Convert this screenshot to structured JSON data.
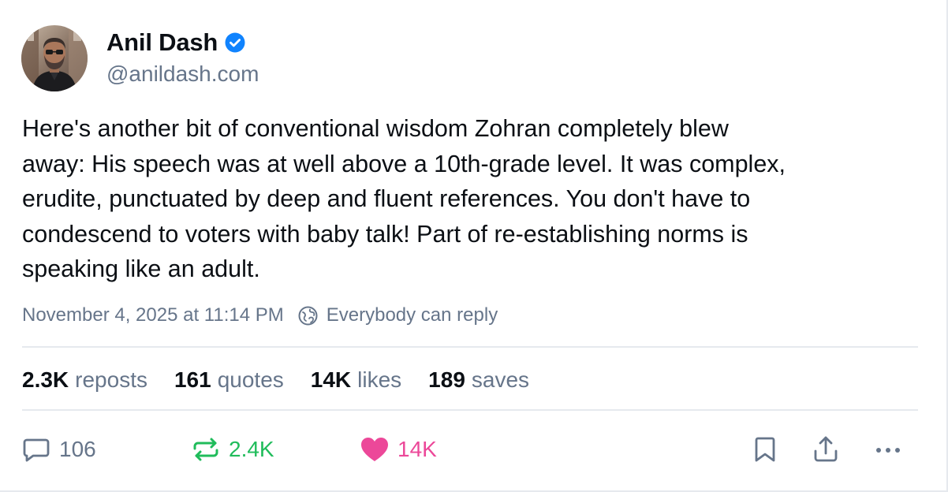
{
  "author": {
    "display_name": "Anil Dash",
    "handle": "@anildash.com",
    "verified": true,
    "avatar_icon": "avatar-photo",
    "verified_icon": "verified-check-icon"
  },
  "post": {
    "text": "Here's another bit of conventional wisdom Zohran completely blew\naway: His speech was at well above a 10th-grade level. It was complex,\nerudite, punctuated by deep and fluent references. You don't have to\ncondescend to voters with baby talk! Part of re-establishing norms is\nspeaking like an adult.",
    "timestamp": "November 4, 2025 at 11:14 PM",
    "reply_setting": "Everybody can reply",
    "reply_setting_icon": "globe-people-icon"
  },
  "stats": [
    {
      "count": "2.3K",
      "label": "reposts"
    },
    {
      "count": "161",
      "label": "quotes"
    },
    {
      "count": "14K",
      "label": "likes"
    },
    {
      "count": "189",
      "label": "saves"
    }
  ],
  "actions": {
    "reply": {
      "count": "106",
      "icon": "speech-bubble-icon"
    },
    "repost": {
      "count": "2.4K",
      "icon": "repost-icon"
    },
    "like": {
      "count": "14K",
      "icon": "heart-icon"
    },
    "bookmark": {
      "icon": "bookmark-icon"
    },
    "share": {
      "icon": "share-icon"
    },
    "more": {
      "icon": "more-dots-icon"
    }
  },
  "colors": {
    "text_primary": "#0b0f14",
    "text_secondary": "#66758a",
    "verified_blue": "#1083fe",
    "repost_green": "#20bc5b",
    "like_pink": "#ec4899",
    "divider": "#e6e9ee"
  }
}
